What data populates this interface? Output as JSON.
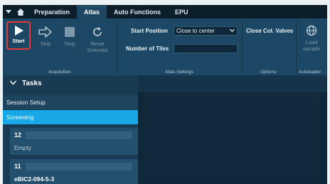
{
  "tabs": [
    "Preparation",
    "Atlas",
    "Auto Functions",
    "EPU"
  ],
  "active_tab": "Atlas",
  "ribbon": {
    "buttons": [
      {
        "label": "Start",
        "icon": "play-icon",
        "enabled": true
      },
      {
        "label": "Skip",
        "icon": "arrow-right-icon",
        "enabled": false
      },
      {
        "label": "Stop",
        "icon": "stop-icon",
        "enabled": false
      },
      {
        "label": "Reset Selected",
        "icon": "refresh-icon",
        "enabled": false
      }
    ],
    "settings": {
      "start_position_label": "Start Position",
      "start_position_value": "Close to center",
      "num_tiles_label": "Number of Tiles",
      "num_tiles_value": ""
    },
    "options": {
      "close_col_valves": "Close Col. Valves"
    },
    "autoloader": {
      "load_sample": "Load sample"
    },
    "groups": {
      "acquisition": "Acquisition",
      "atlas_settings": "Atlas Settings",
      "options": "Options",
      "autoloader": "Autoloader"
    }
  },
  "tasks": {
    "header": "Tasks",
    "items": [
      "Session Setup",
      "Screening"
    ],
    "selected": "Screening"
  },
  "grid_items": [
    {
      "number": "12",
      "status": "Empty"
    },
    {
      "number": "11",
      "status": "eBIC2-094-5-3"
    }
  ],
  "colors": {
    "accent": "#18a8e8",
    "highlight_border": "#e23a3a",
    "ribbon": "#1d4865"
  }
}
